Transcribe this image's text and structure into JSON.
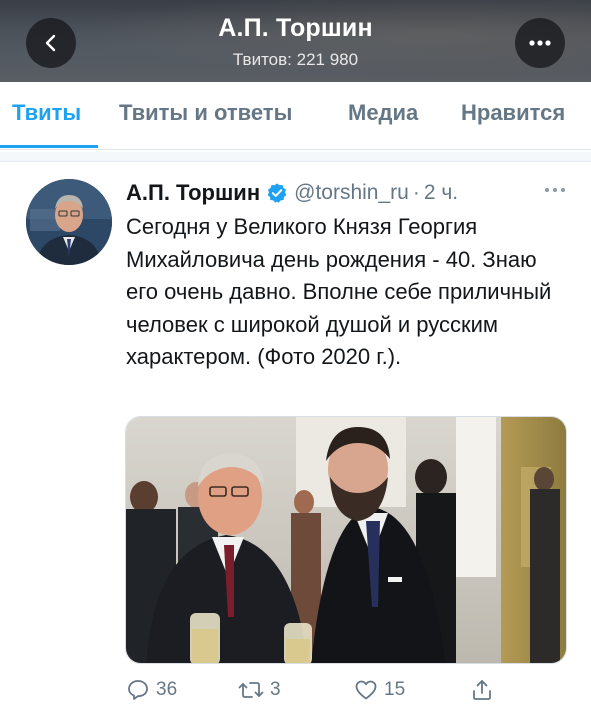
{
  "header": {
    "title": "А.П. Торшин",
    "subtitle": "Твитов: 221 980",
    "back_icon": "chevron-left-icon",
    "more_icon": "more-horizontal-icon"
  },
  "tabs": [
    {
      "label": "Твиты",
      "active": true
    },
    {
      "label": "Твиты и ответы",
      "active": false
    },
    {
      "label": "Медиа",
      "active": false
    },
    {
      "label": "Нравится",
      "active": false
    }
  ],
  "tweet": {
    "name": "А.П. Торшин",
    "handle": "@torshin_ru",
    "separator": "·",
    "time": "2 ч.",
    "text": "Сегодня у Великого Князя Георгия Михайловича день рождения - 40. Знаю его очень давно. Вполне себе приличный человек с широкой душой и русским характером. (Фото 2020 г.).",
    "actions": {
      "reply_count": "36",
      "retweet_count": "3",
      "like_count": "15"
    }
  },
  "colors": {
    "accent": "#1da1f2",
    "muted": "#657786",
    "text": "#14171a"
  }
}
